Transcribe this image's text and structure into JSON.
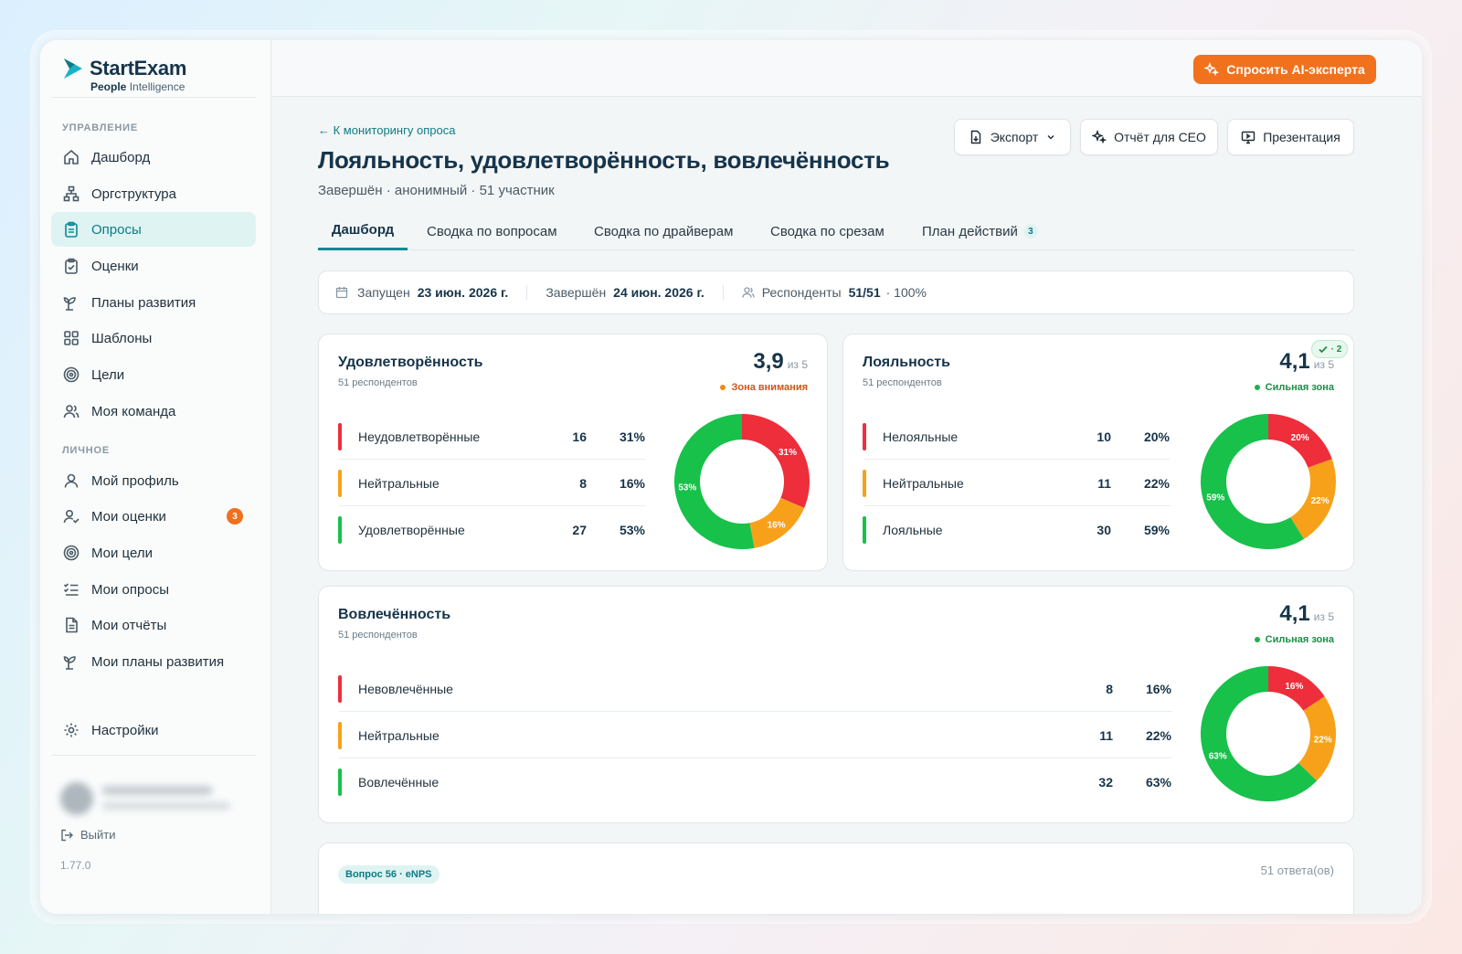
{
  "brand": {
    "name": "StartExam",
    "sub_bold": "People",
    "sub_rest": " Intelligence"
  },
  "sidebar": {
    "section_manage": "УПРАВЛЕНИЕ",
    "section_personal": "ЛИЧНОЕ",
    "manage_items": [
      {
        "label": "Дашборд",
        "icon": "home-icon"
      },
      {
        "label": "Оргструктура",
        "icon": "org-chart-icon"
      },
      {
        "label": "Опросы",
        "icon": "clipboard-icon",
        "active": true
      },
      {
        "label": "Оценки",
        "icon": "clipboard-check-icon"
      },
      {
        "label": "Планы развития",
        "icon": "sprout-icon"
      },
      {
        "label": "Шаблоны",
        "icon": "grid-icon"
      },
      {
        "label": "Цели",
        "icon": "target-icon"
      },
      {
        "label": "Моя команда",
        "icon": "users-icon"
      }
    ],
    "personal_items": [
      {
        "label": "Мой профиль",
        "icon": "user-icon"
      },
      {
        "label": "Мои оценки",
        "icon": "user-check-icon",
        "badge": "3"
      },
      {
        "label": "Мои цели",
        "icon": "target-icon"
      },
      {
        "label": "Мои опросы",
        "icon": "list-check-icon"
      },
      {
        "label": "Мои отчёты",
        "icon": "document-icon"
      },
      {
        "label": "Мои планы развития",
        "icon": "sprout-icon"
      }
    ],
    "settings": "Настройки",
    "logout": "Выйти",
    "version": "1.77.0"
  },
  "topbar": {
    "ai_button": "Спросить AI-эксперта"
  },
  "header": {
    "back_link": "← К мониторингу опроса",
    "title": "Лояльность, удовлетворённость, вовлечённость",
    "subtitle": "Завершён · анонимный · 51 участник",
    "export": "Экспорт",
    "ceo_report": "Отчёт для CEO",
    "presentation": "Презентация"
  },
  "tabs": [
    {
      "label": "Дашборд",
      "active": true
    },
    {
      "label": "Сводка по вопросам"
    },
    {
      "label": "Сводка по драйверам"
    },
    {
      "label": "Сводка по срезам"
    },
    {
      "label": "План действий",
      "count": "3"
    }
  ],
  "info": {
    "launched_label": "Запущен",
    "launched_value": "23 июн. 2026 г.",
    "finished_label": "Завершён",
    "finished_value": "24 июн. 2026 г.",
    "respondents_label": "Респонденты",
    "respondents_value": "51/51",
    "respondents_pct": "· 100%"
  },
  "colors": {
    "red": "#ee2e3b",
    "orange": "#f7a11a",
    "green": "#17c14a",
    "attention": "#f08a12",
    "strong": "#1fb14d"
  },
  "cards": [
    {
      "title": "Удовлетворённость",
      "sub": "51 респондентов",
      "score": "3,9",
      "of": "из 5",
      "zone": "Зона внимания",
      "zone_color": "#f08a12",
      "zone_text_color": "#d2541a",
      "rows": [
        {
          "label": "Неудовлетворённые",
          "n": "16",
          "pct": "31%",
          "color": "#ee2e3b"
        },
        {
          "label": "Нейтральные",
          "n": "8",
          "pct": "16%",
          "color": "#f7a11a"
        },
        {
          "label": "Удовлетворённые",
          "n": "27",
          "pct": "53%",
          "color": "#17c14a"
        }
      ]
    },
    {
      "title": "Лояльность",
      "sub": "51 респондентов",
      "score": "4,1",
      "of": "из 5",
      "zone": "Сильная зона",
      "zone_color": "#1fb14d",
      "zone_text_color": "#1a8f46",
      "check": "· 2",
      "rows": [
        {
          "label": "Нелояльные",
          "n": "10",
          "pct": "20%",
          "color": "#ee2e3b"
        },
        {
          "label": "Нейтральные",
          "n": "11",
          "pct": "22%",
          "color": "#f7a11a"
        },
        {
          "label": "Лояльные",
          "n": "30",
          "pct": "59%",
          "color": "#17c14a"
        }
      ]
    },
    {
      "title": "Вовлечённость",
      "sub": "51 респондентов",
      "score": "4,1",
      "of": "из 5",
      "zone": "Сильная зона",
      "zone_color": "#1fb14d",
      "zone_text_color": "#1a8f46",
      "rows": [
        {
          "label": "Невовлечённые",
          "n": "8",
          "pct": "16%",
          "color": "#ee2e3b"
        },
        {
          "label": "Нейтральные",
          "n": "11",
          "pct": "22%",
          "color": "#f7a11a"
        },
        {
          "label": "Вовлечённые",
          "n": "32",
          "pct": "63%",
          "color": "#17c14a"
        }
      ]
    }
  ],
  "question": {
    "pill": "Вопрос 56 · eNPS",
    "count": "51 ответа(ов)"
  }
}
